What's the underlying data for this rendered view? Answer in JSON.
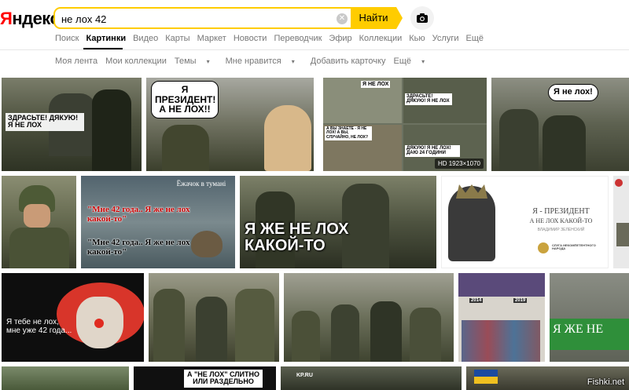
{
  "brand": {
    "logo_first": "Я",
    "logo_rest": "ндекс"
  },
  "search": {
    "query": "не лох 42",
    "button_label": "Найти"
  },
  "service_nav": [
    "Поиск",
    "Картинки",
    "Видео",
    "Карты",
    "Маркет",
    "Новости",
    "Переводчик",
    "Эфир",
    "Коллекции",
    "Кью",
    "Услуги",
    "Ещё"
  ],
  "sub_nav": {
    "my_feed": "Моя лента",
    "my_collections": "Мои коллекции",
    "themes": "Темы",
    "likes": "Мне нравится",
    "add_card": "Добавить карточку",
    "more": "Ещё"
  },
  "tiles": {
    "t1": {
      "caption": "ЗДРАСЬТЕ! ДЯКУЮ! Я НЕ ЛОХ"
    },
    "t2": {
      "caption": "Я ПРЕЗИДЕНТ! А НЕ ЛОХ!!"
    },
    "t3": {
      "caption_a": "Я НЕ ЛОХ",
      "caption_b": "ЗДРАСЬТЕ! ДЯКУЮ! Я НЕ ЛОХ",
      "caption_c": "А ВЫ ЗНАЕТЕ - Я НЕ ЛОХ! А ВЫ, СЛУЧАЙНО, НЕ ЛОХ?",
      "caption_d": "ДЯКУЮ! Я НЕ ЛОХ! ДАЮ 24 ГОДИНИ",
      "hd": "HD 1923×1070"
    },
    "t4": {
      "caption": "Я не лох!"
    },
    "t6": {
      "caption_top": "Ёжачок в тумані",
      "caption_1": "\"Мне 42 года.. Я же не лох какой-то\"",
      "caption_2": "\"Мне 42 года.. Я же не лох какой-то\""
    },
    "t7": {
      "caption": "Я ЖЕ НЕ ЛОХ КАКОЙ-ТО"
    },
    "t8": {
      "caption_1": "Я - ПРЕЗИДЕНТ",
      "caption_2": "А НЕ ЛОХ КАКОЙ-ТО",
      "caption_3": "ВЛАДИМИР ЗЕЛЕНСКИЙ",
      "caption_4": "СЛУГА НЕКОМПЕТЕНТНОГО НАРОДА"
    },
    "t10": {
      "caption": "Я тебе не лох, мне уже 42 года..."
    },
    "t13": {
      "label_1": "2014",
      "label_2": "2019"
    },
    "t14": {
      "caption": "Я ЖЕ НЕ"
    },
    "t16": {
      "caption": "А \"НЕ ЛОХ\" СЛИТНО ИЛИ РАЗДЕЛЬНО"
    },
    "t17": {
      "caption": "KP.RU"
    }
  },
  "watermark": "Fishki.net",
  "colors": {
    "accent": "#fc0",
    "brand_red": "#f00",
    "nav_gray": "#777"
  }
}
